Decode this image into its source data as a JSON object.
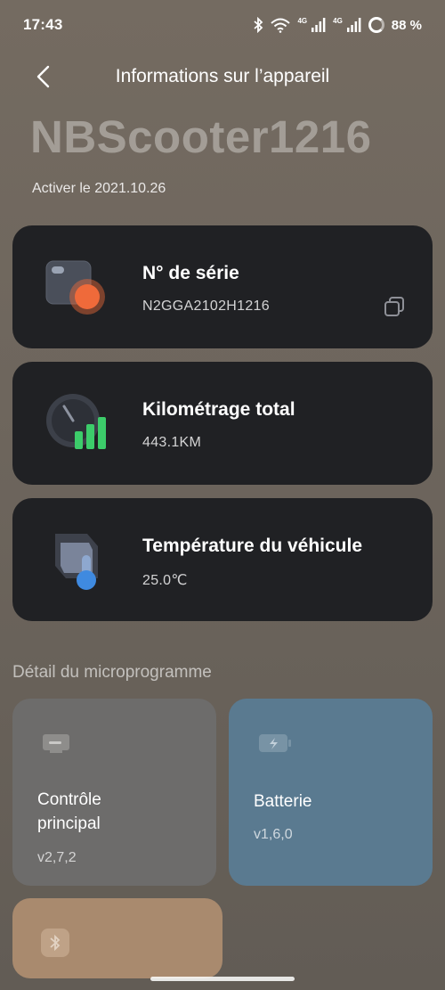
{
  "status_bar": {
    "time": "17:43",
    "network_label_1": "4G",
    "network_label_2": "4G",
    "battery": "88 %"
  },
  "header": {
    "title": "Informations sur l’appareil"
  },
  "device": {
    "name": "NBScooter1216",
    "activation": "Activer le 2021.10.26"
  },
  "cards": {
    "serial": {
      "title": "N° de série",
      "value": "N2GGA2102H1216",
      "icon": "serial-icon"
    },
    "mileage": {
      "title": "Kilométrage total",
      "value": "443.1KM",
      "icon": "gauge-icon"
    },
    "temperature": {
      "title": "Température du véhicule",
      "value": "25.0℃",
      "icon": "thermometer-icon"
    }
  },
  "firmware": {
    "section_title": "Détail du microprogramme",
    "items": [
      {
        "title_line1": "Contrôle",
        "title_line2": "principal",
        "version": "v2,7,2",
        "color": "#6d6c6b",
        "icon": "controller-icon"
      },
      {
        "title_line1": "Batterie",
        "version": "v1,6,0",
        "color": "#5a7a90",
        "icon": "battery-icon"
      },
      {
        "color": "#a98a6e",
        "icon": "bluetooth-icon"
      }
    ]
  },
  "colors": {
    "card_bg": "#202124",
    "accent_orange": "#ef6a3a",
    "accent_green": "#3ccc6a",
    "accent_blue": "#3f8ae0"
  }
}
